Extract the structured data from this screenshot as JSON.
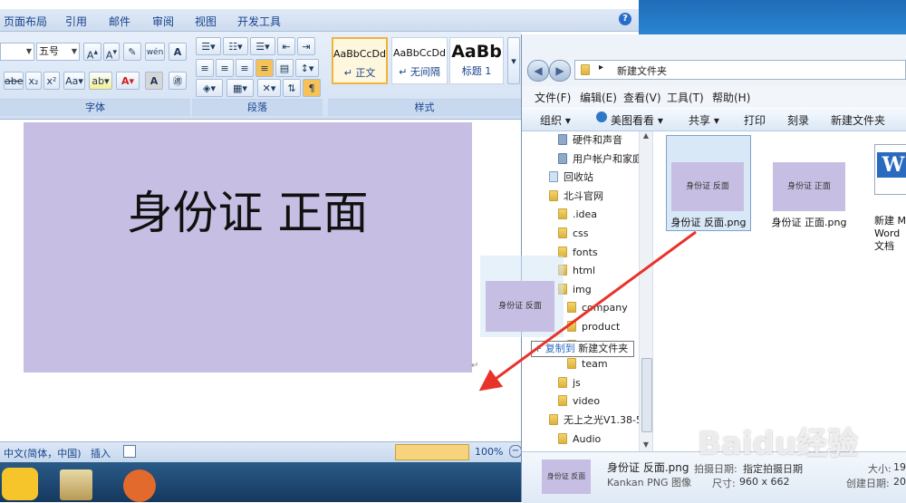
{
  "word": {
    "menu": [
      "页面布局",
      "引用",
      "邮件",
      "审阅",
      "视图",
      "开发工具"
    ],
    "help_icon": "?",
    "font_combo": "",
    "size_combo": "五号",
    "font_group_label": "字体",
    "paragraph_group_label": "段落",
    "styles_group_label": "样式",
    "styles": [
      {
        "sample": "AaBbCcDd",
        "name": "↵ 正文"
      },
      {
        "sample": "AaBbCcDd",
        "name": "↵ 无间隔"
      },
      {
        "sample": "AaBb",
        "name": "标题 1"
      }
    ],
    "doc_image_text": "身份证 正面",
    "status": {
      "language": "中文(简体，中国)",
      "mode": "插入",
      "zoom": "100%"
    }
  },
  "explorer": {
    "breadcrumb": "新建文件夹",
    "menu": [
      "文件(F)",
      "编辑(E)",
      "查看(V)",
      "工具(T)",
      "帮助(H)"
    ],
    "commands": [
      "组织 ▾",
      "美图看看 ▾",
      "共享 ▾",
      "打印",
      "刻录",
      "新建文件夹"
    ],
    "nav_items": [
      {
        "label": "硬件和声音",
        "indent": 1,
        "type": "cp"
      },
      {
        "label": "用户帐户和家庭",
        "indent": 1,
        "type": "cp"
      },
      {
        "label": "回收站",
        "indent": 0,
        "type": "bin"
      },
      {
        "label": "北斗官网",
        "indent": 0,
        "type": "folder"
      },
      {
        "label": ".idea",
        "indent": 1,
        "type": "folder"
      },
      {
        "label": "css",
        "indent": 1,
        "type": "folder"
      },
      {
        "label": "fonts",
        "indent": 1,
        "type": "folder"
      },
      {
        "label": "html",
        "indent": 1,
        "type": "folder"
      },
      {
        "label": "img",
        "indent": 1,
        "type": "folder"
      },
      {
        "label": "company",
        "indent": 2,
        "type": "folder"
      },
      {
        "label": "product",
        "indent": 2,
        "type": "folder"
      },
      {
        "label": "",
        "indent": 2,
        "type": "folder"
      },
      {
        "label": "team",
        "indent": 2,
        "type": "folder"
      },
      {
        "label": "js",
        "indent": 1,
        "type": "folder"
      },
      {
        "label": "video",
        "indent": 1,
        "type": "folder"
      },
      {
        "label": "无上之光V1.38-5",
        "indent": 0,
        "type": "folder"
      },
      {
        "label": "Audio",
        "indent": 1,
        "type": "folder"
      }
    ],
    "files": [
      {
        "thumb_text": "身份证 反面",
        "label": "身份证 反面.png",
        "selected": true
      },
      {
        "thumb_text": "身份证 正面",
        "label": "身份证 正面.png",
        "selected": false
      },
      {
        "thumb_text": "W",
        "label": "新建 M\nWord\n文档",
        "selected": false
      }
    ],
    "copy_tooltip": {
      "prefix": "复制到",
      "target": "新建文件夹"
    },
    "drag_thumb_text": "身份证 反面",
    "details": {
      "thumb_text": "身份证 反面",
      "filename": "身份证 反面.png",
      "type": "Kankan PNG 图像",
      "taken_label": "拍摄日期:",
      "taken_value": "指定拍摄日期",
      "dims_label": "尺寸:",
      "dims_value": "960 x 662",
      "size_label": "大小:",
      "size_value": "19",
      "created_label": "创建日期:",
      "created_value": "20"
    }
  },
  "watermark": "Baidu经验"
}
